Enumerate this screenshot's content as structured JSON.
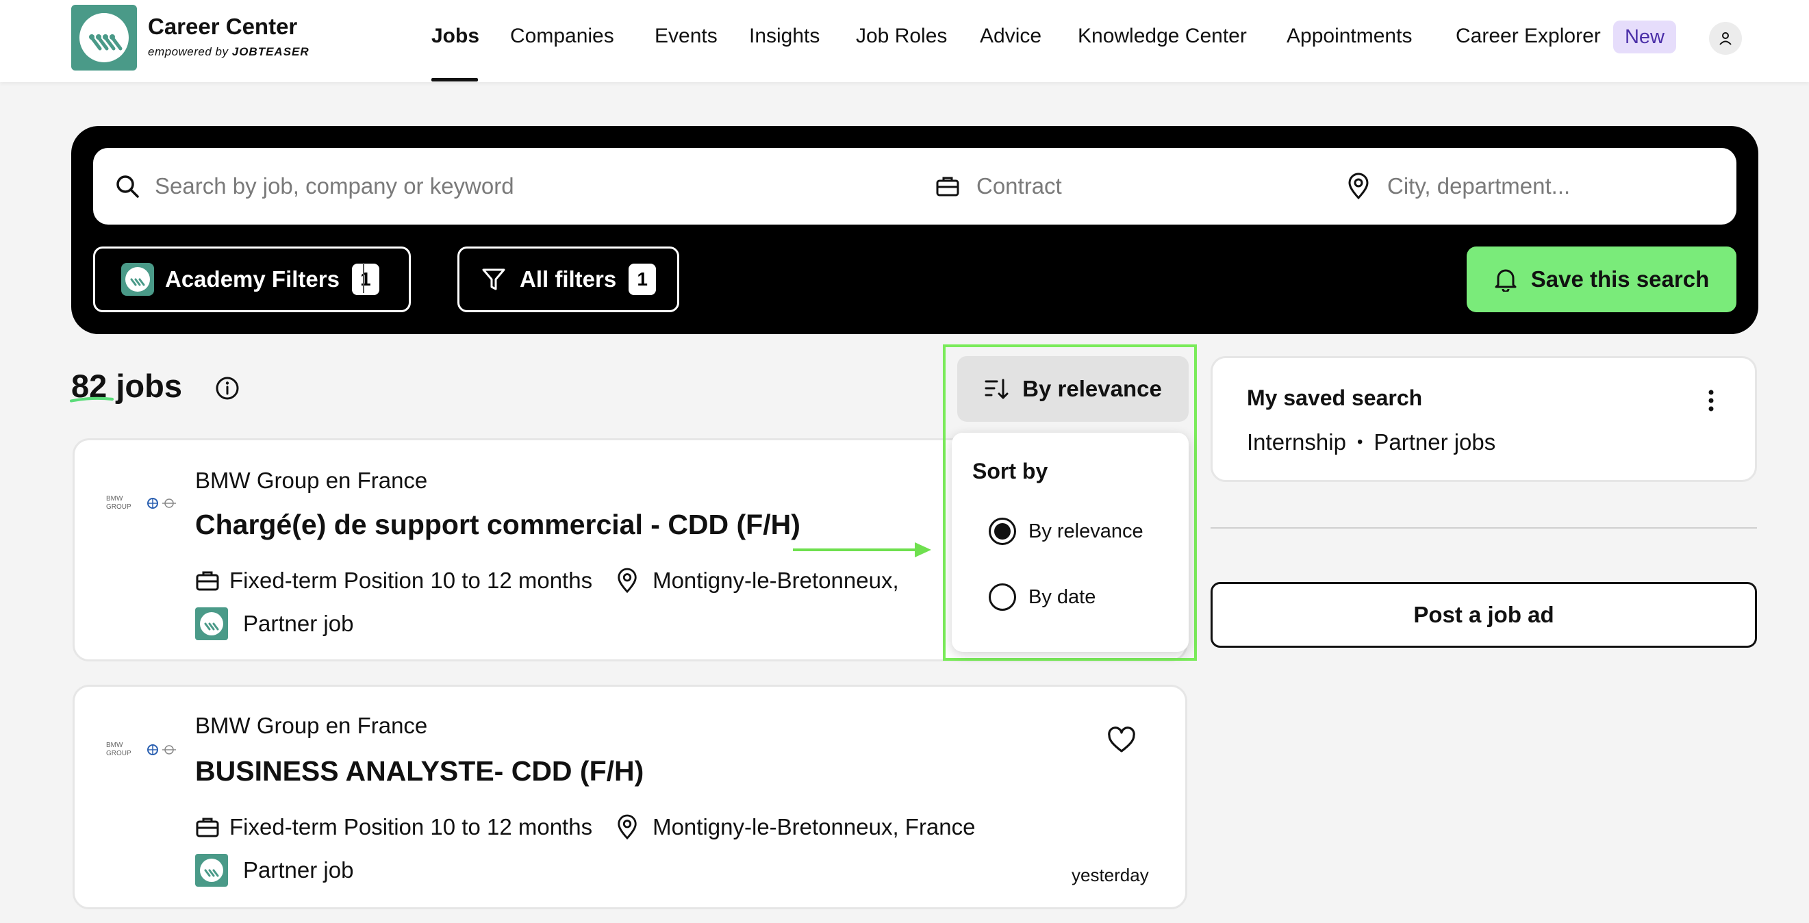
{
  "header": {
    "brand_title": "Career Center",
    "brand_sub_prefix": "empowered by",
    "brand_sub_name": "JOBTEASER",
    "nav": [
      {
        "label": "Jobs",
        "active": true
      },
      {
        "label": "Companies"
      },
      {
        "label": "Events"
      },
      {
        "label": "Insights"
      },
      {
        "label": "Job Roles"
      },
      {
        "label": "Advice"
      },
      {
        "label": "Knowledge Center"
      },
      {
        "label": "Appointments"
      },
      {
        "label": "Career Explorer"
      }
    ],
    "new_badge": "New"
  },
  "search": {
    "keyword_placeholder": "Search by job, company or keyword",
    "contract_placeholder": "Contract",
    "location_placeholder": "City, department...",
    "academy_filters_label": "Academy Filters",
    "academy_filters_count": "1",
    "all_filters_label": "All filters",
    "all_filters_count": "1",
    "save_search_label": "Save this search"
  },
  "results": {
    "count": "82",
    "count_suffix": "jobs"
  },
  "sort": {
    "button_label": "By relevance",
    "menu_title": "Sort by",
    "options": [
      {
        "label": "By relevance",
        "selected": true
      },
      {
        "label": "By date",
        "selected": false
      }
    ]
  },
  "jobs": [
    {
      "company": "BMW Group en France",
      "title": "Chargé(e) de support commercial - CDD (F/H)",
      "contract": "Fixed-term Position 10 to 12 months",
      "location": "Montigny-le-Bretonneux,",
      "partner": "Partner job",
      "date": ""
    },
    {
      "company": "BMW Group en France",
      "title": "BUSINESS ANALYSTE- CDD (F/H)",
      "contract": "Fixed-term Position 10 to 12 months",
      "location": "Montigny-le-Bretonneux, France",
      "partner": "Partner job",
      "date": "yesterday"
    }
  ],
  "saved_search": {
    "title": "My saved search",
    "tags": [
      "Internship",
      "Partner jobs"
    ]
  },
  "post_ad_label": "Post a job ad",
  "colors": {
    "brand_teal": "#4a9a88",
    "accent_green": "#7aeb7a",
    "new_badge_bg": "#e6ddfb",
    "new_badge_text": "#4b2fa8",
    "highlight_green": "#7aeb5a"
  }
}
